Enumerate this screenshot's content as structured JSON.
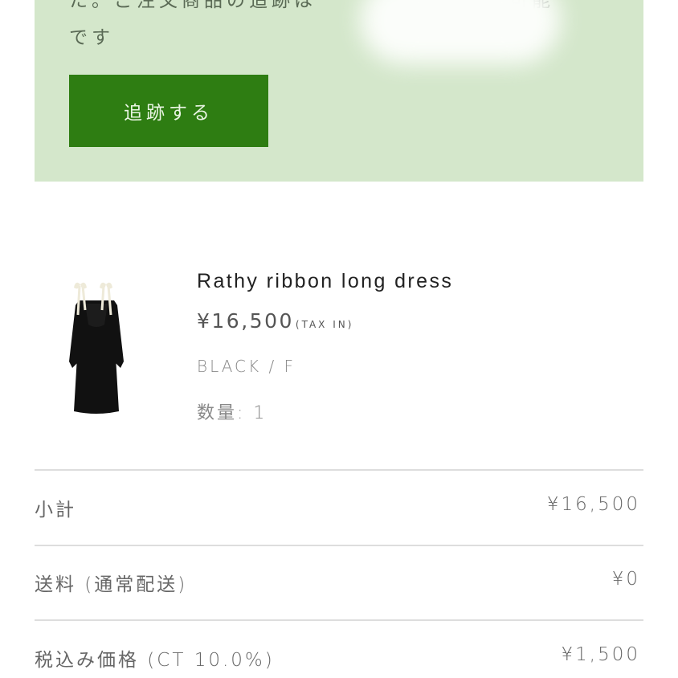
{
  "notice": {
    "line1_part1": "た。ご注文商品の追跡は",
    "line1_part2": "可能",
    "line2": "です",
    "track_button_label": "追跡する"
  },
  "product": {
    "name": "Rathy ribbon long dress",
    "price": "¥16,500",
    "tax_note": "(TAX IN)",
    "variant": "BLACK / F",
    "quantity": "数量: 1"
  },
  "summary": {
    "subtotal_label": "小計",
    "subtotal_value": "¥16,500",
    "shipping_label": "送料 (通常配送)",
    "shipping_value": "¥0",
    "tax_label": "税込み価格 (CT 10.0%)",
    "tax_value": "¥1,500"
  },
  "colors": {
    "notice_background": "#d4e7cb",
    "button_background": "#2e7d12"
  }
}
